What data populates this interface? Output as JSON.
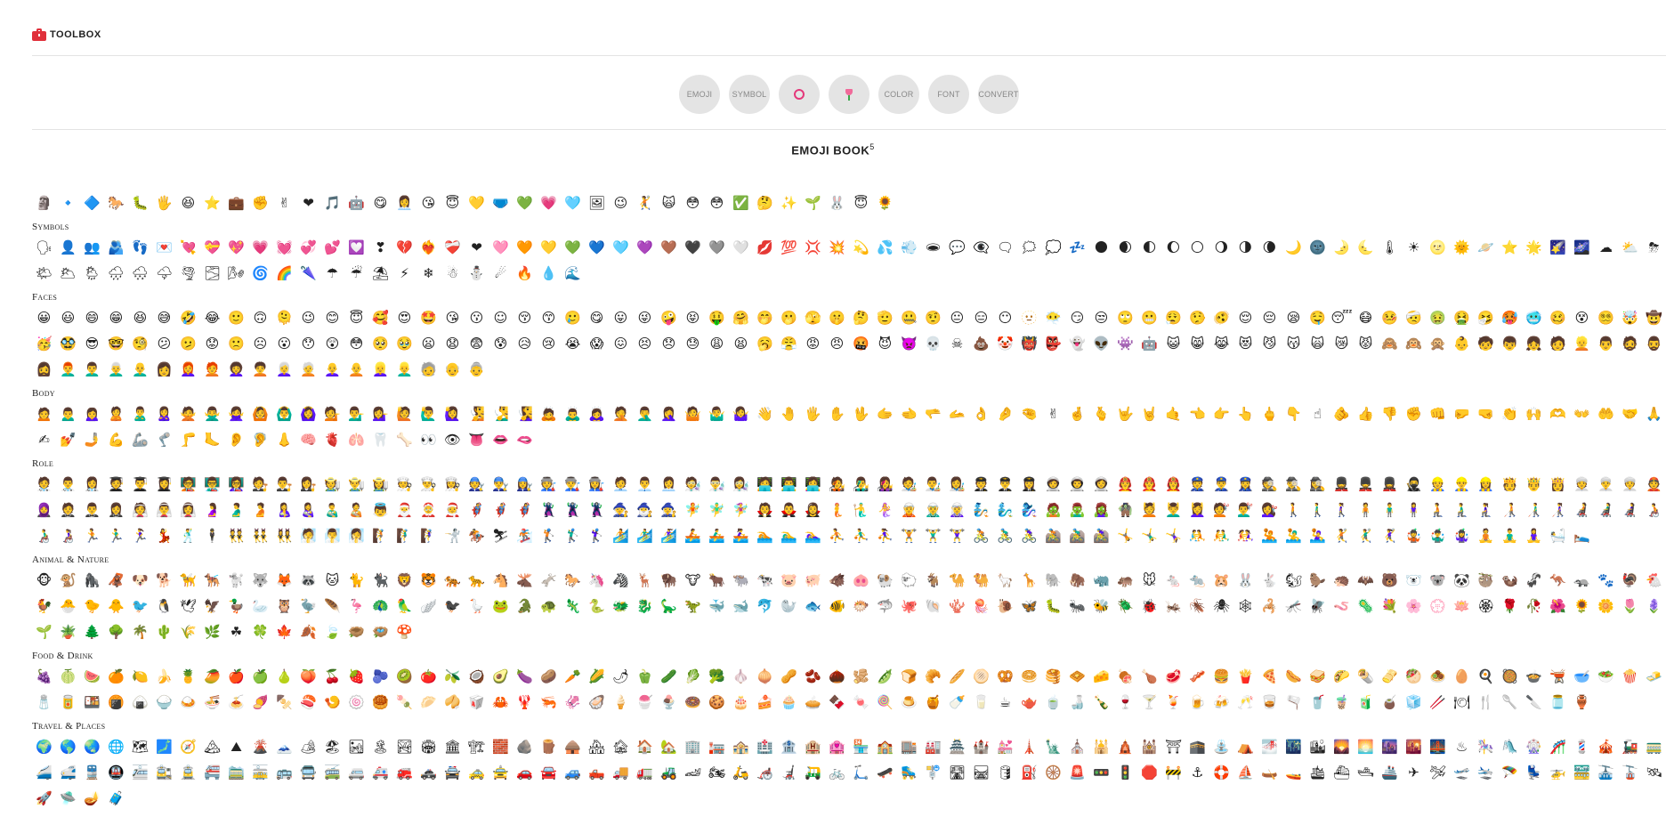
{
  "app": {
    "logo_text": "TOOLBOX",
    "brand_color": "#e0303b"
  },
  "nav": {
    "items": [
      {
        "label": "EMOJI",
        "icon": ""
      },
      {
        "label": "SYMBOL",
        "icon": ""
      },
      {
        "label": "",
        "icon": "ring-icon"
      },
      {
        "label": "",
        "icon": "tulip-icon"
      },
      {
        "label": "COLOR",
        "icon": ""
      },
      {
        "label": "FONT",
        "icon": ""
      },
      {
        "label": "CONVERT",
        "icon": ""
      }
    ]
  },
  "page": {
    "title": "EMOJI BOOK",
    "title_sup": "5"
  },
  "recent": {
    "emojis": [
      "🗿",
      "🔹",
      "🔷",
      "🐎",
      "🐛",
      "🖐",
      "😆",
      "⭐",
      "💼",
      "✊",
      "✌",
      "❤",
      "🎵",
      "🤖",
      "😋",
      "👩‍💼",
      "😘",
      "😇",
      "💛",
      "🩲",
      "💚",
      "💗",
      "🩵",
      "🖼",
      "😉",
      "🤾",
      "🙀",
      "😳",
      "😳",
      "✅",
      "🤔",
      "✨",
      "🌱",
      "🐰",
      "😇",
      "🌻"
    ]
  },
  "sections": [
    {
      "title": "Symbols",
      "emojis": [
        "🗣",
        "👤",
        "👥",
        "🫂",
        "👣",
        "💌",
        "💘",
        "💝",
        "💖",
        "💗",
        "💓",
        "💞",
        "💕",
        "💟",
        "❣",
        "💔",
        "❤‍🔥",
        "❤‍🩹",
        "❤",
        "🩷",
        "🧡",
        "💛",
        "💚",
        "💙",
        "🩵",
        "💜",
        "🤎",
        "🖤",
        "🩶",
        "🤍",
        "💋",
        "💯",
        "💢",
        "💥",
        "💫",
        "💦",
        "💨",
        "🕳",
        "💬",
        "👁‍🗨",
        "🗨",
        "🗯",
        "💭",
        "💤",
        "🌑",
        "🌒",
        "🌓",
        "🌔",
        "🌕",
        "🌖",
        "🌗",
        "🌘",
        "🌙",
        "🌚",
        "🌛",
        "🌜",
        "🌡",
        "☀",
        "🌝",
        "🌞",
        "🪐",
        "⭐",
        "🌟",
        "🌠",
        "🌌",
        "☁",
        "⛅",
        "⛈",
        "🌤",
        "🌥",
        "🌦",
        "🌧",
        "🌨",
        "🌩",
        "🌪",
        "🌫",
        "🌬",
        "🌀",
        "🌈",
        "🌂",
        "☂",
        "☔",
        "⛱",
        "⚡",
        "❄",
        "☃",
        "⛄",
        "☄",
        "🔥",
        "💧",
        "🌊"
      ]
    },
    {
      "title": "Faces",
      "emojis": [
        "😀",
        "😃",
        "😄",
        "😁",
        "😆",
        "😅",
        "🤣",
        "😂",
        "🙂",
        "🙃",
        "🫠",
        "😉",
        "😊",
        "😇",
        "🥰",
        "😍",
        "🤩",
        "😘",
        "😗",
        "☺",
        "😚",
        "😙",
        "🥲",
        "😋",
        "😛",
        "😜",
        "🤪",
        "😝",
        "🤑",
        "🤗",
        "🤭",
        "🫢",
        "🫣",
        "🤫",
        "🤔",
        "🫡",
        "🤐",
        "🤨",
        "😐",
        "😑",
        "😶",
        "🫥",
        "😶‍🌫",
        "😏",
        "😒",
        "🙄",
        "😬",
        "😮‍💨",
        "🤥",
        "🫨",
        "😌",
        "😔",
        "😪",
        "🤤",
        "😴",
        "😷",
        "🤒",
        "🤕",
        "🤢",
        "🤮",
        "🤧",
        "🥵",
        "🥶",
        "🥴",
        "😵",
        "😵‍💫",
        "🤯",
        "🤠",
        "🥳",
        "🥸",
        "😎",
        "🤓",
        "🧐",
        "😕",
        "🫤",
        "😟",
        "🙁",
        "☹",
        "😮",
        "😯",
        "😲",
        "😳",
        "🥺",
        "🥹",
        "😦",
        "😧",
        "😨",
        "😰",
        "😥",
        "😢",
        "😭",
        "😱",
        "😖",
        "😣",
        "😞",
        "😓",
        "😩",
        "😫",
        "🥱",
        "😤",
        "😡",
        "😠",
        "🤬",
        "😈",
        "👿",
        "💀",
        "☠",
        "💩",
        "🤡",
        "👹",
        "👺",
        "👻",
        "👽",
        "👾",
        "🤖",
        "😺",
        "😸",
        "😹",
        "😻",
        "😼",
        "😽",
        "🙀",
        "😿",
        "😾",
        "🙈",
        "🙉",
        "🙊",
        "👶",
        "🧒",
        "👦",
        "👧",
        "🧑",
        "👱",
        "👨",
        "🧔",
        "🧔‍♂",
        "🧔‍♀",
        "👨‍🦰",
        "👨‍🦱",
        "👨‍🦳",
        "👨‍🦲",
        "👩",
        "👩‍🦰",
        "🧑‍🦰",
        "👩‍🦱",
        "🧑‍🦱",
        "👩‍🦳",
        "🧑‍🦳",
        "👩‍🦲",
        "🧑‍🦲",
        "👱‍♀",
        "👱‍♂",
        "🧓",
        "👴",
        "👵"
      ]
    },
    {
      "title": "Body",
      "emojis": [
        "🙍",
        "🙍‍♂",
        "🙍‍♀",
        "🙎",
        "🙎‍♂",
        "🙎‍♀",
        "🙅",
        "🙅‍♂",
        "🙅‍♀",
        "🙆",
        "🙆‍♂",
        "🙆‍♀",
        "💁",
        "💁‍♂",
        "💁‍♀",
        "🙋",
        "🙋‍♂",
        "🙋‍♀",
        "🧏",
        "🧏‍♂",
        "🧏‍♀",
        "🙇",
        "🙇‍♂",
        "🙇‍♀",
        "🤦",
        "🤦‍♂",
        "🤦‍♀",
        "🤷",
        "🤷‍♂",
        "🤷‍♀",
        "👋",
        "🤚",
        "🖐",
        "✋",
        "🖖",
        "🫱",
        "🫲",
        "🫳",
        "🫴",
        "👌",
        "🤌",
        "🤏",
        "✌",
        "🤞",
        "🫰",
        "🤟",
        "🤘",
        "🤙",
        "👈",
        "👉",
        "👆",
        "🖕",
        "👇",
        "☝",
        "🫵",
        "👍",
        "👎",
        "✊",
        "👊",
        "🤛",
        "🤜",
        "👏",
        "🙌",
        "🫶",
        "👐",
        "🤲",
        "🤝",
        "🙏",
        "✍",
        "💅",
        "🤳",
        "💪",
        "🦾",
        "🦿",
        "🦵",
        "🦶",
        "👂",
        "🦻",
        "👃",
        "🧠",
        "🫀",
        "🫁",
        "🦷",
        "🦴",
        "👀",
        "👁",
        "👅",
        "👄",
        "🫦"
      ]
    },
    {
      "title": "Role",
      "emojis": [
        "🧑‍⚕",
        "👨‍⚕",
        "👩‍⚕",
        "🧑‍🎓",
        "👨‍🎓",
        "👩‍🎓",
        "🧑‍🏫",
        "👨‍🏫",
        "👩‍🏫",
        "🧑‍⚖",
        "👨‍⚖",
        "👩‍⚖",
        "🧑‍🌾",
        "👨‍🌾",
        "👩‍🌾",
        "🧑‍🍳",
        "👨‍🍳",
        "👩‍🍳",
        "🧑‍🔧",
        "👨‍🔧",
        "👩‍🔧",
        "🧑‍🏭",
        "👨‍🏭",
        "👩‍🏭",
        "🧑‍💼",
        "👨‍💼",
        "👩‍💼",
        "🧑‍🔬",
        "👨‍🔬",
        "👩‍🔬",
        "🧑‍💻",
        "👨‍💻",
        "👩‍💻",
        "🧑‍🎤",
        "👨‍🎤",
        "👩‍🎤",
        "🧑‍🎨",
        "👨‍🎨",
        "👩‍🎨",
        "🧑‍✈",
        "👨‍✈",
        "👩‍✈",
        "🧑‍🚀",
        "👨‍🚀",
        "👩‍🚀",
        "🧑‍🚒",
        "👨‍🚒",
        "👩‍🚒",
        "👮",
        "👮‍♂",
        "👮‍♀",
        "🕵",
        "🕵‍♂",
        "🕵‍♀",
        "💂",
        "💂‍♂",
        "💂‍♀",
        "🥷",
        "👷",
        "👷‍♂",
        "👷‍♀",
        "🫅",
        "🤴",
        "👸",
        "👳",
        "👳‍♂",
        "👳‍♀",
        "👲",
        "🧕",
        "🤵",
        "🤵‍♂",
        "🤵‍♀",
        "👰",
        "👰‍♂",
        "👰‍♀",
        "🤰",
        "🫃",
        "🫄",
        "🤱",
        "👩‍🍼",
        "👨‍🍼",
        "🧑‍🍼",
        "👼",
        "🎅",
        "🤶",
        "🧑‍🎄",
        "🦸",
        "🦸‍♂",
        "🦸‍♀",
        "🦹",
        "🦹‍♂",
        "🦹‍♀",
        "🧙",
        "🧙‍♂",
        "🧙‍♀",
        "🧚",
        "🧚‍♂",
        "🧚‍♀",
        "🧛",
        "🧛‍♂",
        "🧛‍♀",
        "🧜",
        "🧜‍♂",
        "🧜‍♀",
        "🧝",
        "🧝‍♂",
        "🧝‍♀",
        "🧞",
        "🧞‍♂",
        "🧞‍♀",
        "🧟",
        "🧟‍♂",
        "🧟‍♀",
        "🧌",
        "💆",
        "💆‍♂",
        "💆‍♀",
        "💇",
        "💇‍♂",
        "💇‍♀",
        "🚶",
        "🚶‍♂",
        "🚶‍♀",
        "🧍",
        "🧍‍♂",
        "🧍‍♀",
        "🧎",
        "🧎‍♂",
        "🧎‍♀",
        "🧑‍🦯",
        "👨‍🦯",
        "👩‍🦯",
        "🧑‍🦼",
        "👨‍🦼",
        "👩‍🦼",
        "🧑‍🦽",
        "👨‍🦽",
        "👩‍🦽",
        "🏃",
        "🏃‍♂",
        "🏃‍♀",
        "💃",
        "🕺",
        "🕴",
        "👯",
        "👯‍♂",
        "👯‍♀",
        "🧖",
        "🧖‍♂",
        "🧖‍♀",
        "🧗",
        "🧗‍♂",
        "🧗‍♀",
        "🤺",
        "🏇",
        "⛷",
        "🏂",
        "🏌",
        "🏌‍♂",
        "🏌‍♀",
        "🏄",
        "🏄‍♂",
        "🏄‍♀",
        "🚣",
        "🚣‍♂",
        "🚣‍♀",
        "🏊",
        "🏊‍♂",
        "🏊‍♀",
        "⛹",
        "⛹‍♂",
        "⛹‍♀",
        "🏋",
        "🏋‍♂",
        "🏋‍♀",
        "🚴",
        "🚴‍♂",
        "🚴‍♀",
        "🚵",
        "🚵‍♂",
        "🚵‍♀",
        "🤸",
        "🤸‍♂",
        "🤸‍♀",
        "🤼",
        "🤼‍♂",
        "🤼‍♀",
        "🤽",
        "🤽‍♂",
        "🤽‍♀",
        "🤾",
        "🤾‍♂",
        "🤾‍♀",
        "🤹",
        "🤹‍♂",
        "🤹‍♀",
        "🧘",
        "🧘‍♂",
        "🧘‍♀",
        "🛀",
        "🛌"
      ]
    },
    {
      "title": "Animal & Nature",
      "emojis": [
        "🐵",
        "🐒",
        "🦍",
        "🦧",
        "🐶",
        "🐕",
        "🦮",
        "🐕‍🦺",
        "🐩",
        "🐺",
        "🦊",
        "🦝",
        "🐱",
        "🐈",
        "🐈‍⬛",
        "🦁",
        "🐯",
        "🐅",
        "🐆",
        "🐴",
        "🫎",
        "🫏",
        "🐎",
        "🦄",
        "🦓",
        "🦌",
        "🦬",
        "🐮",
        "🐂",
        "🐃",
        "🐄",
        "🐷",
        "🐖",
        "🐗",
        "🐽",
        "🐏",
        "🐑",
        "🐐",
        "🐪",
        "🐫",
        "🦙",
        "🦒",
        "🐘",
        "🦣",
        "🦏",
        "🦛",
        "🐭",
        "🐁",
        "🐀",
        "🐹",
        "🐰",
        "🐇",
        "🐿",
        "🦫",
        "🦔",
        "🦇",
        "🐻",
        "🐻‍❄",
        "🐨",
        "🐼",
        "🦥",
        "🦦",
        "🦨",
        "🦘",
        "🦡",
        "🐾",
        "🦃",
        "🐔",
        "🐓",
        "🐣",
        "🐤",
        "🐥",
        "🐦",
        "🐧",
        "🕊",
        "🦅",
        "🦆",
        "🦢",
        "🦉",
        "🦤",
        "🪶",
        "🦩",
        "🦚",
        "🦜",
        "🪽",
        "🐦‍⬛",
        "🪿",
        "🐸",
        "🐊",
        "🐢",
        "🦎",
        "🐍",
        "🐲",
        "🐉",
        "🦕",
        "🦖",
        "🐳",
        "🐋",
        "🐬",
        "🦭",
        "🐟",
        "🐠",
        "🐡",
        "🦈",
        "🐙",
        "🐚",
        "🪸",
        "🪼",
        "🐌",
        "🦋",
        "🐛",
        "🐜",
        "🐝",
        "🪲",
        "🐞",
        "🦗",
        "🪳",
        "🕷",
        "🕸",
        "🦂",
        "🦟",
        "🪰",
        "🪱",
        "🦠",
        "💐",
        "🌸",
        "💮",
        "🪷",
        "🏵",
        "🌹",
        "🥀",
        "🌺",
        "🌻",
        "🌼",
        "🌷",
        "🪻",
        "🌱",
        "🪴",
        "🌲",
        "🌳",
        "🌴",
        "🌵",
        "🌾",
        "🌿",
        "☘",
        "🍀",
        "🍁",
        "🍂",
        "🍃",
        "🪹",
        "🪺",
        "🍄"
      ]
    },
    {
      "title": "Food & Drink",
      "emojis": [
        "🍇",
        "🍈",
        "🍉",
        "🍊",
        "🍋",
        "🍌",
        "🍍",
        "🥭",
        "🍎",
        "🍏",
        "🍐",
        "🍑",
        "🍒",
        "🍓",
        "🫐",
        "🥝",
        "🍅",
        "🫒",
        "🥥",
        "🥑",
        "🍆",
        "🥔",
        "🥕",
        "🌽",
        "🌶",
        "🫑",
        "🥒",
        "🥬",
        "🥦",
        "🧄",
        "🧅",
        "🥜",
        "🫘",
        "🌰",
        "🫚",
        "🫛",
        "🍞",
        "🥐",
        "🥖",
        "🫓",
        "🥨",
        "🥯",
        "🥞",
        "🧇",
        "🧀",
        "🍖",
        "🍗",
        "🥩",
        "🥓",
        "🍔",
        "🍟",
        "🍕",
        "🌭",
        "🥪",
        "🌮",
        "🌯",
        "🫔",
        "🥙",
        "🧆",
        "🥚",
        "🍳",
        "🥘",
        "🍲",
        "🫕",
        "🥣",
        "🥗",
        "🍿",
        "🧈",
        "🧂",
        "🥫",
        "🍱",
        "🍘",
        "🍙",
        "🍚",
        "🍛",
        "🍜",
        "🍝",
        "🍠",
        "🍢",
        "🍣",
        "🍤",
        "🍥",
        "🥮",
        "🍡",
        "🥟",
        "🥠",
        "🥡",
        "🦀",
        "🦞",
        "🦐",
        "🦑",
        "🦪",
        "🍦",
        "🍧",
        "🍨",
        "🍩",
        "🍪",
        "🎂",
        "🍰",
        "🧁",
        "🥧",
        "🍫",
        "🍬",
        "🍭",
        "🍮",
        "🍯",
        "🍼",
        "🥛",
        "☕",
        "🫖",
        "🍵",
        "🍶",
        "🍾",
        "🍷",
        "🍸",
        "🍹",
        "🍺",
        "🍻",
        "🥂",
        "🥃",
        "🫗",
        "🥤",
        "🧋",
        "🧃",
        "🧉",
        "🧊",
        "🥢",
        "🍽",
        "🍴",
        "🥄",
        "🔪",
        "🫙",
        "🏺"
      ]
    },
    {
      "title": "Travel & Places",
      "emojis": [
        "🌍",
        "🌎",
        "🌏",
        "🌐",
        "🗺",
        "🗾",
        "🧭",
        "🏔",
        "⛰",
        "🌋",
        "🗻",
        "🏕",
        "🏖",
        "🏜",
        "🏝",
        "🏞",
        "🏟",
        "🏛",
        "🏗",
        "🧱",
        "🪨",
        "🪵",
        "🛖",
        "🏘",
        "🏚",
        "🏠",
        "🏡",
        "🏢",
        "🏣",
        "🏤",
        "🏥",
        "🏦",
        "🏨",
        "🏩",
        "🏪",
        "🏫",
        "🏬",
        "🏭",
        "🏯",
        "🏰",
        "💒",
        "🗼",
        "🗽",
        "⛪",
        "🕌",
        "🛕",
        "🕍",
        "⛩",
        "🕋",
        "⛲",
        "⛺",
        "🌁",
        "🌃",
        "🏙",
        "🌄",
        "🌅",
        "🌆",
        "🌇",
        "🌉",
        "♨",
        "🎠",
        "🛝",
        "🎡",
        "🎢",
        "💈",
        "🎪",
        "🚂",
        "🚃",
        "🚄",
        "🚅",
        "🚆",
        "🚇",
        "🚈",
        "🚉",
        "🚊",
        "🚝",
        "🚞",
        "🚋",
        "🚌",
        "🚍",
        "🚎",
        "🚐",
        "🚑",
        "🚒",
        "🚓",
        "🚔",
        "🚕",
        "🚖",
        "🚗",
        "🚘",
        "🚙",
        "🛻",
        "🚚",
        "🚛",
        "🚜",
        "🏎",
        "🏍",
        "🛵",
        "🦽",
        "🦼",
        "🛺",
        "🚲",
        "🛴",
        "🛹",
        "🛼",
        "🚏",
        "🛣",
        "🛤",
        "🛢",
        "⛽",
        "🛞",
        "🚨",
        "🚥",
        "🚦",
        "🛑",
        "🚧",
        "⚓",
        "🛟",
        "⛵",
        "🛶",
        "🚤",
        "🛳",
        "⛴",
        "🛥",
        "🚢",
        "✈",
        "🛩",
        "🛫",
        "🛬",
        "🪂",
        "💺",
        "🚁",
        "🚟",
        "🚠",
        "🚡",
        "🛰",
        "🚀",
        "🛸",
        "🪔",
        "🧳"
      ]
    }
  ]
}
